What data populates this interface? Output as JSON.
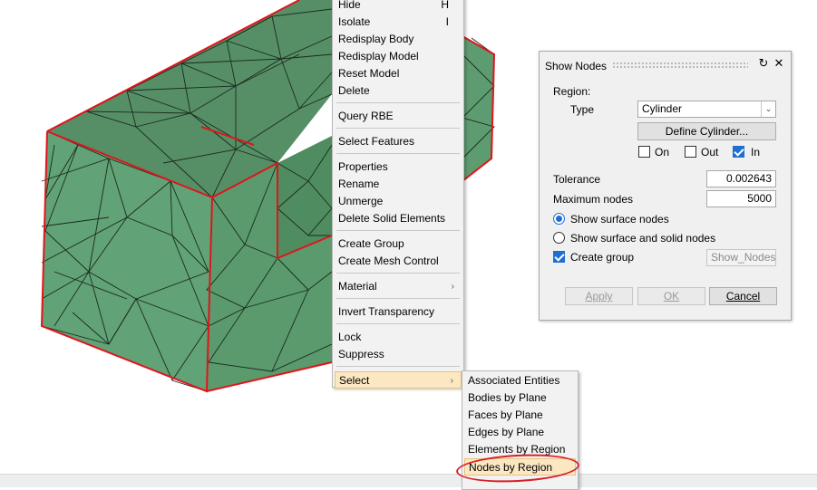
{
  "context_menu": {
    "items": [
      {
        "label": "Hide",
        "hotkey": "H"
      },
      {
        "label": "Isolate",
        "hotkey": "I"
      },
      {
        "label": "Redisplay Body"
      },
      {
        "label": "Redisplay Model"
      },
      {
        "label": "Reset Model"
      },
      {
        "label": "Delete"
      },
      {
        "label": "Query RBE"
      },
      {
        "label": "Select Features"
      },
      {
        "label": "Properties"
      },
      {
        "label": "Rename"
      },
      {
        "label": "Unmerge"
      },
      {
        "label": "Delete Solid Elements"
      },
      {
        "label": "Create Group"
      },
      {
        "label": "Create Mesh Control"
      },
      {
        "label": "Material",
        "submenu": true
      },
      {
        "label": "Invert Transparency"
      },
      {
        "label": "Lock"
      },
      {
        "label": "Suppress"
      },
      {
        "label": "Select",
        "submenu": true,
        "highlighted": true
      }
    ]
  },
  "submenu": {
    "items": [
      {
        "label": "Associated Entities"
      },
      {
        "label": "Bodies by Plane"
      },
      {
        "label": "Faces by Plane"
      },
      {
        "label": "Edges by Plane"
      },
      {
        "label": "Elements by Region"
      },
      {
        "label": "Nodes by Region",
        "highlighted": true,
        "circled": true
      }
    ]
  },
  "dialog": {
    "title": "Show Nodes",
    "region_label": "Region:",
    "type_label": "Type",
    "type_value": "Cylinder",
    "define_button": "Define Cylinder...",
    "on_label": "On",
    "on_checked": false,
    "out_label": "Out",
    "out_checked": false,
    "in_label": "In",
    "in_checked": true,
    "tolerance_label": "Tolerance",
    "tolerance_value": "0.002643",
    "max_nodes_label": "Maximum nodes",
    "max_nodes_value": "5000",
    "radio_surface": "Show surface nodes",
    "radio_surface_selected": true,
    "radio_solid": "Show surface and solid nodes",
    "radio_solid_selected": false,
    "create_group_label": "Create group",
    "create_group_checked": true,
    "group_name_value": "Show_Nodes",
    "apply_button": "Apply",
    "ok_button": "OK",
    "cancel_button": "Cancel"
  },
  "colors": {
    "mesh_face": "#5f9e72",
    "mesh_top": "#4f8a5f",
    "mesh_edge": "#e0141c",
    "menu_highlight": "#fbe8c2",
    "annotation_circle": "#d61f26",
    "accent_blue": "#1e6fd0"
  }
}
